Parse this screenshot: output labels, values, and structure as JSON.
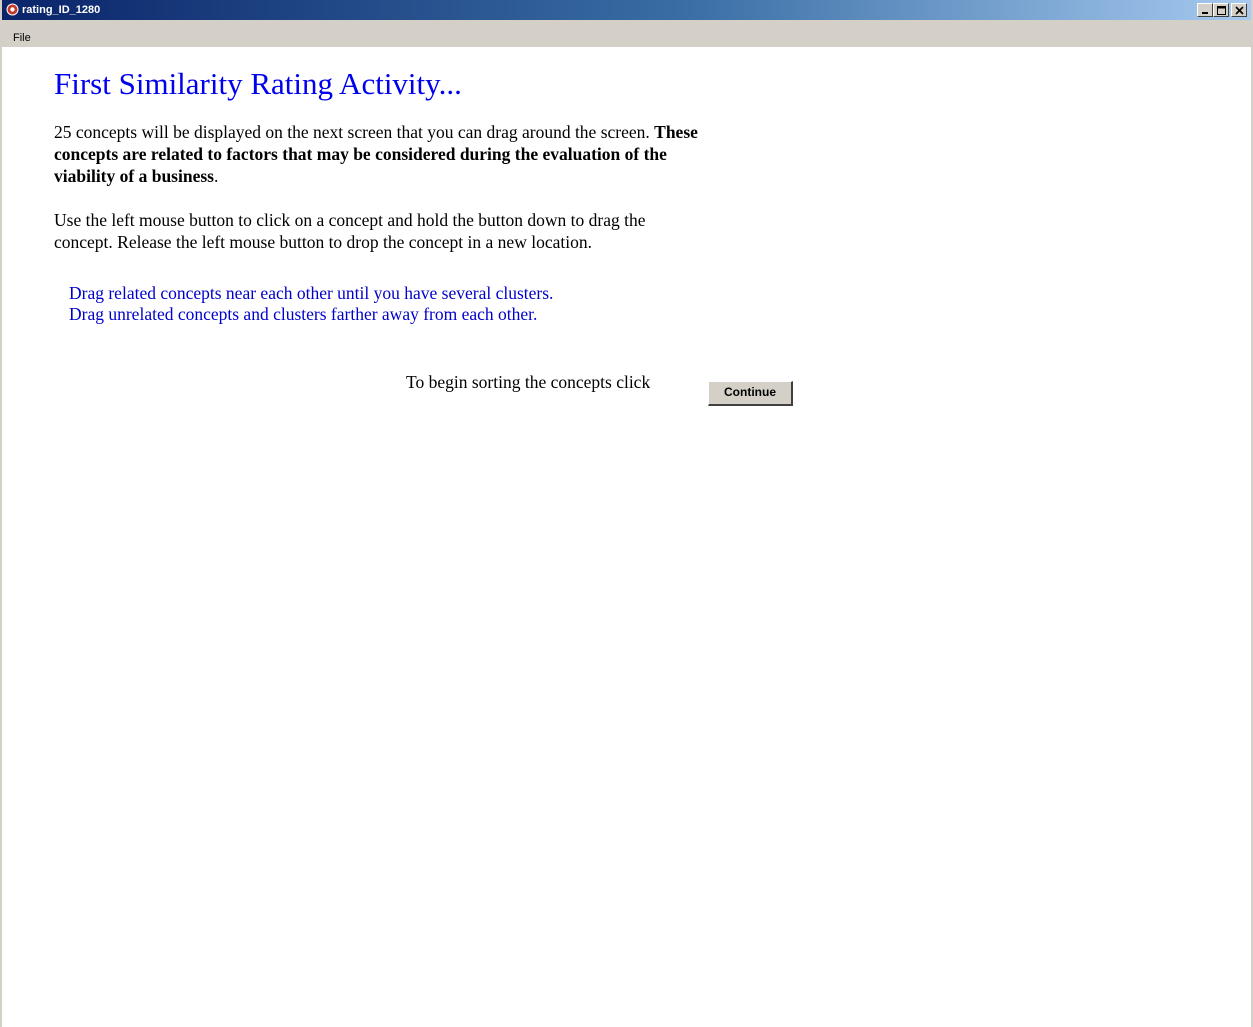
{
  "window": {
    "title": "rating_ID_1280",
    "title_color": "#0a246a"
  },
  "menu": {
    "items": [
      "File"
    ]
  },
  "main": {
    "heading": "First Similarity Rating Activity...",
    "para1_normal": "25 concepts will be displayed on the next screen that you can drag around the screen. ",
    "para1_bold": "These concepts are related to factors that may be considered during the evaluation of the viability of a business",
    "para1_end": ".",
    "para2": "Use the left mouse button to click on a concept and hold the button down to drag the concept.  Release the left mouse button to drop the concept in a new location.",
    "instruction1": "Drag related concepts near each other until you have several clusters.",
    "instruction2": "Drag unrelated concepts and clusters farther away from each other.",
    "begin_text": "To begin sorting the concepts click",
    "continue_label": "Continue",
    "heading_color": "#0000ee",
    "instruction_color": "#0000cc"
  }
}
